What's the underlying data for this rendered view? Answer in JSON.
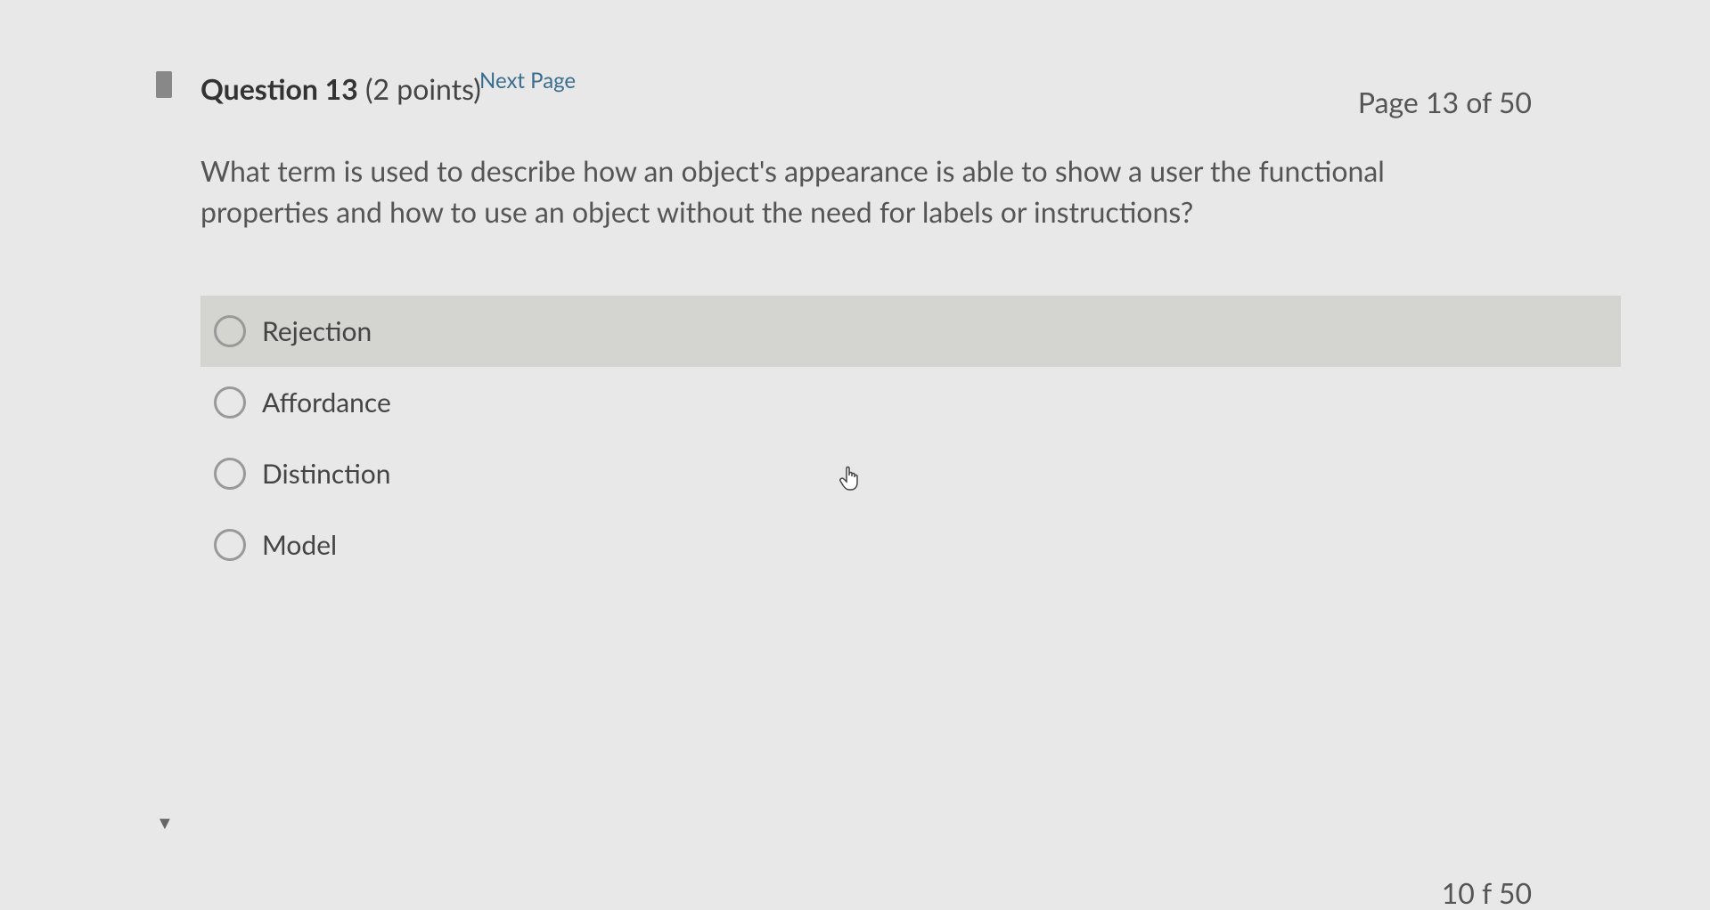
{
  "nav": {
    "next_page": "Next Page",
    "page_indicator": "Page 13 of 50"
  },
  "question": {
    "label": "Question 13",
    "points": "(2 points)",
    "text": "What term is used to describe how an object's appearance is able to show a user the functional properties and how to use an object without the need for labels or instructions?"
  },
  "options": [
    {
      "label": "Rejection",
      "hovered": true
    },
    {
      "label": "Affordance",
      "hovered": false
    },
    {
      "label": "Distinction",
      "hovered": false
    },
    {
      "label": "Model",
      "hovered": false
    }
  ],
  "footer": {
    "page_fragment": "10  f 50"
  }
}
